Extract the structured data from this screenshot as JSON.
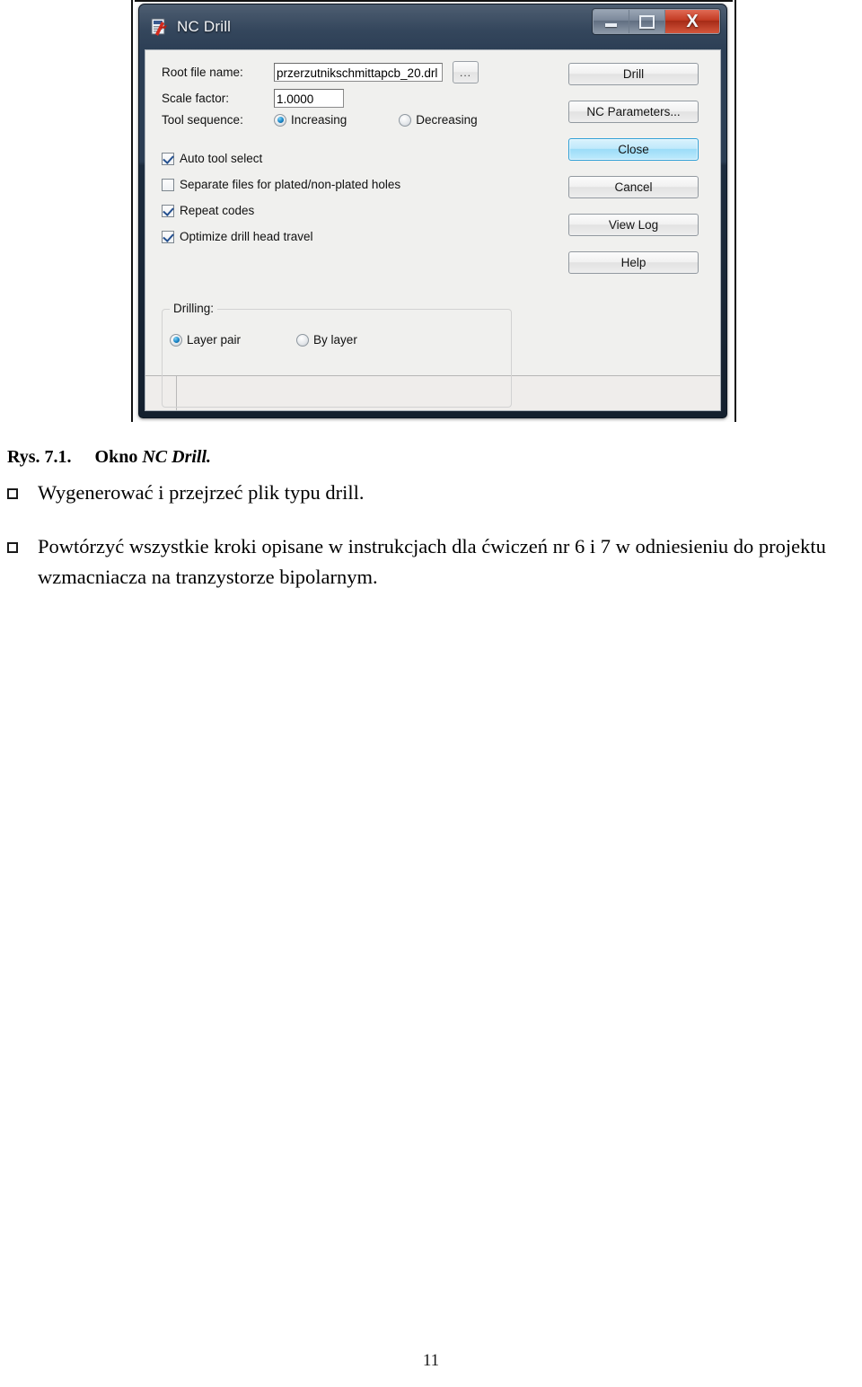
{
  "figure": {
    "window": {
      "title": "NC Drill",
      "app_icon": "document-drill-icon",
      "controls": {
        "minimize": "minimize-icon",
        "maximize": "maximize-icon",
        "close": "X"
      }
    },
    "form": {
      "root_file_name": {
        "label": "Root file name:",
        "value": "przerzutnikschmittapcb_20.drl",
        "browse_label": "..."
      },
      "scale_factor": {
        "label": "Scale factor:",
        "value": "1.0000"
      },
      "tool_sequence": {
        "label": "Tool sequence:",
        "options": [
          "Increasing",
          "Decreasing"
        ],
        "selected": "Increasing"
      }
    },
    "checkboxes": [
      {
        "label": "Auto tool select",
        "checked": true
      },
      {
        "label": "Separate files for plated/non-plated holes",
        "checked": false
      },
      {
        "label": "Repeat codes",
        "checked": true
      },
      {
        "label": "Optimize drill head travel",
        "checked": true
      }
    ],
    "drilling_group": {
      "label": "Drilling:",
      "options": [
        "Layer pair",
        "By layer"
      ],
      "selected": "Layer pair"
    },
    "buttons": [
      {
        "label": "Drill",
        "focused": false
      },
      {
        "label": "NC Parameters...",
        "focused": false
      },
      {
        "label": "Close",
        "focused": true
      },
      {
        "label": "Cancel",
        "focused": false
      },
      {
        "label": "View Log",
        "focused": false
      },
      {
        "label": "Help",
        "focused": false
      }
    ],
    "colors": {
      "titlebar": "#2c3f56",
      "close_button": "#c23a22",
      "focused_button": "#9bdcf8",
      "dialog_background": "#f0f0ee"
    }
  },
  "document": {
    "caption": {
      "number": "Rys. 7.1.",
      "lead": "Okno",
      "italic": "NC Drill."
    },
    "bullets": [
      "Wygenerować i przejrzeć plik typu drill.",
      "Powtórzyć wszystkie kroki opisane w instrukcjach dla ćwiczeń nr 6 i 7 w odniesieniu do projektu wzmacniacza na tranzystorze bipolarnym."
    ],
    "page_number": "11"
  }
}
